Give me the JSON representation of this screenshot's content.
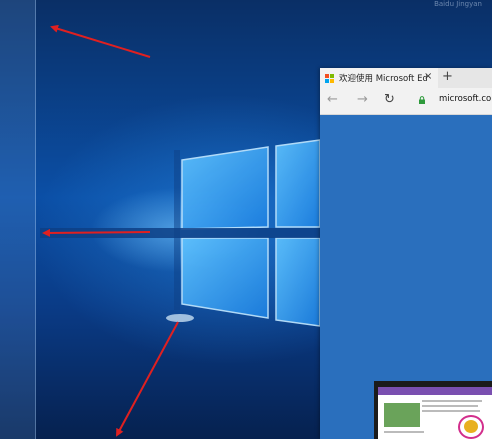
{
  "watermark": "Baidu Jingyan",
  "browser": {
    "tab_title": "欢迎使用 Microsoft Edg",
    "close_glyph": "×",
    "new_tab_glyph": "+",
    "back_glyph": "←",
    "forward_glyph": "→",
    "refresh_glyph": "↻",
    "url": "microsoft.com/"
  },
  "colors": {
    "annotation_arrow": "#e02020",
    "edge_logo": [
      "#f25022",
      "#7fba00",
      "#00a4ef",
      "#ffb900"
    ],
    "page_background": "#2a6fbd"
  }
}
